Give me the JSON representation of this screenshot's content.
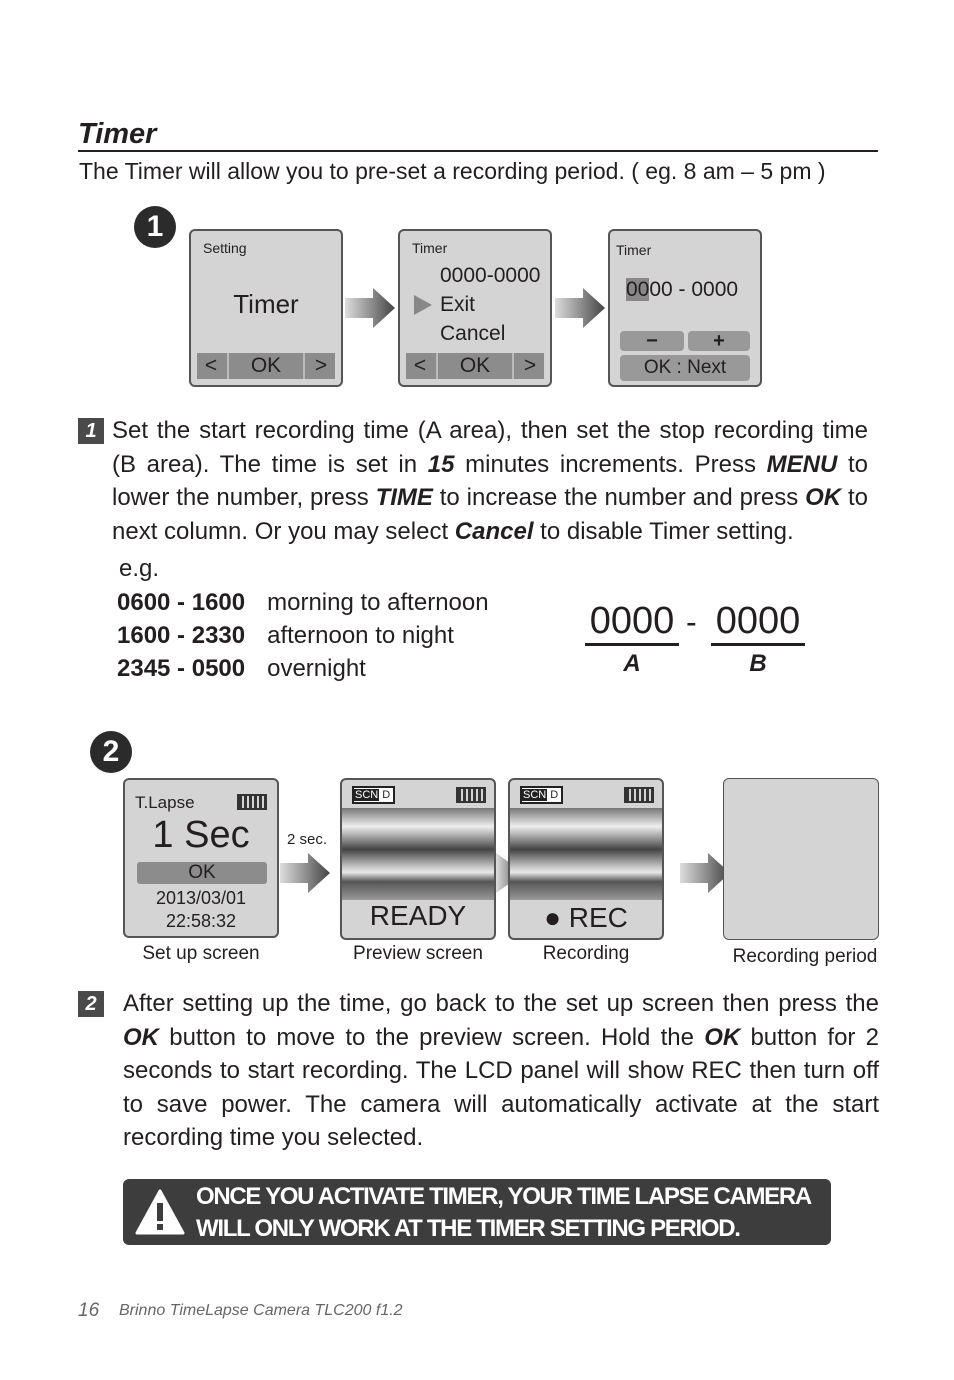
{
  "title": "Timer",
  "intro": "The Timer will allow you to pre-set a recording period. ( eg. 8 am – 5 pm )",
  "step1": {
    "badge": "1",
    "screen1": {
      "header": "Setting",
      "main": "Timer",
      "ok": "OK"
    },
    "screen2": {
      "header": "Timer",
      "items": [
        "0000-0000",
        "Exit",
        "Cancel"
      ],
      "ok": "OK"
    },
    "screen3": {
      "header": "Timer",
      "time_highlight": "00",
      "time_rest": "00 - 0000",
      "minus": "−",
      "plus": "+",
      "next": "OK : Next"
    },
    "num": "1",
    "text": {
      "a": "Set the start recording time (A area), then set the stop recording time (B area). The time is set in ",
      "b": "15",
      "c": " minutes increments. Press ",
      "d": "MENU",
      "e": " to lower the number, press ",
      "f": "TIME",
      "g": " to increase the number and press ",
      "h": "OK",
      "i": " to next column. Or you may select ",
      "j": "Cancel",
      "k": " to disable Timer setting."
    },
    "eg_label": "e.g.",
    "examples": [
      {
        "range": "0600 - 1600",
        "desc": "morning to afternoon"
      },
      {
        "range": "1600 - 2330",
        "desc": "afternoon to night"
      },
      {
        "range": "2345 - 0500",
        "desc": "overnight"
      }
    ],
    "diagram": {
      "a_value": "0000",
      "sep": "-",
      "b_value": "0000",
      "a_label": "A",
      "b_label": "B"
    }
  },
  "step2": {
    "badge": "2",
    "setup": {
      "mode": "T.Lapse",
      "interval": "1 Sec",
      "ok": "OK",
      "date": "2013/03/01",
      "time": "22:58:32",
      "caption": "Set up screen"
    },
    "delay": "2 sec.",
    "preview": {
      "scn": "SCN",
      "d": "D",
      "status": "READY",
      "caption": "Preview screen"
    },
    "recording": {
      "scn": "SCN",
      "d": "D",
      "status": "● REC",
      "caption": "Recording"
    },
    "period": {
      "caption": "Recording period"
    },
    "num": "2",
    "text": {
      "a": "After setting up the time, go back to the set up screen then press the ",
      "b": "OK",
      "c": " button to move to the preview screen. Hold the ",
      "d": "OK",
      "e": " button for 2 seconds to start recording.  The LCD panel will show REC then turn off to save power. The camera will automatically activate at the start recording time you selected."
    }
  },
  "warning": {
    "line1": "ONCE YOU ACTIVATE TIMER, YOUR TIME LAPSE CAMERA",
    "line2": "WILL ONLY WORK AT THE TIMER SETTING PERIOD."
  },
  "footer": {
    "page": "16",
    "text": "Brinno TimeLapse Camera  TLC200 f1.2"
  }
}
